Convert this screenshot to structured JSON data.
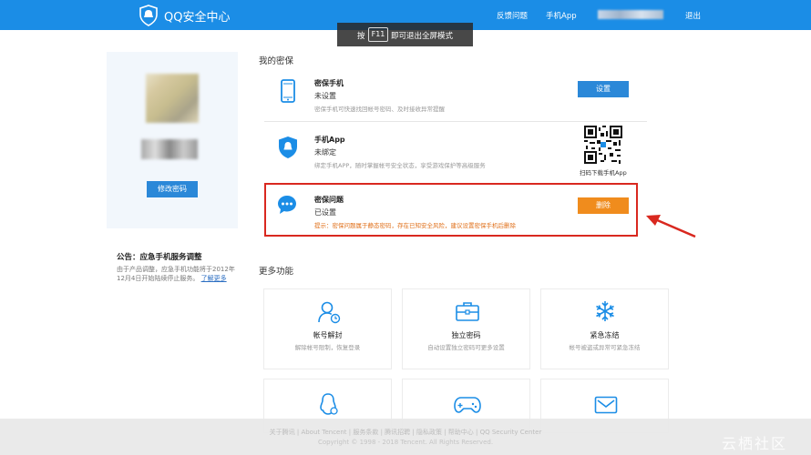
{
  "header": {
    "brand": "QQ安全中心",
    "nav": [
      "反馈问题",
      "手机App",
      "退出"
    ],
    "fullscreen_hint": {
      "pre": "按",
      "key": "F11",
      "post": "即可退出全屏模式"
    }
  },
  "sidebar": {
    "change_password": "修改密码",
    "notice_title": "公告：应急手机服务调整",
    "notice_body": "由于产品调整，应急手机功能将于2012年12月4日开始陆续停止服务。",
    "notice_link": "了解更多"
  },
  "my_protection": {
    "title": "我的密保",
    "items": [
      {
        "name": "密保手机",
        "status": "未设置",
        "desc": "密保手机可快速找回帐号密码、及时接收异常提醒",
        "button": "设置"
      },
      {
        "name": "手机App",
        "status": "未绑定",
        "desc": "绑定手机APP，随时掌握帐号安全状态，享受游戏保护等高级服务",
        "qr_caption": "扫码下载手机App"
      },
      {
        "name": "密保问题",
        "status": "已设置",
        "tip": "提示：密保问题属于静态密码，存在已知安全风险，建议设置密保手机后删除",
        "button": "删除"
      }
    ]
  },
  "more_features": {
    "title": "更多功能",
    "cards": [
      {
        "title": "帐号解封",
        "desc": "解除帐号限制，恢复登录"
      },
      {
        "title": "独立密码",
        "desc": "自动设置独立密码可更多设置"
      },
      {
        "title": "紧急冻结",
        "desc": "帐号被盗或异常可紧急冻结"
      }
    ]
  },
  "footer": {
    "links": "关于腾讯 | About Tencent | 服务条款 | 腾讯招聘 | 隐私政策 | 帮助中心 | QQ Security Center",
    "copyright": "Copyright © 1998 - 2018 Tencent. All Rights Reserved."
  },
  "watermark": "云栖社区",
  "colors": {
    "primary": "#1b8de6",
    "button": "#2b88d8",
    "danger": "#f08c1d",
    "highlight": "#d9281f"
  }
}
